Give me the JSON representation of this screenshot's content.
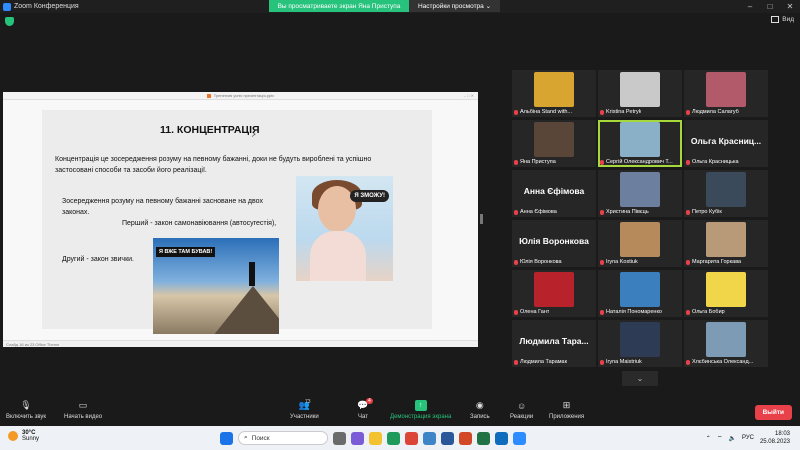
{
  "window": {
    "title": "Zoom Конференция"
  },
  "banner": {
    "viewing": "Вы просматриваете экран Яна Приступа",
    "settings": "Настройки просмотра"
  },
  "view_label": "Вид",
  "share": {
    "tab_title": "Тренінгові успіх презентація.pptx",
    "slide": {
      "title": "11. КОНЦЕНТРАЦІЯ",
      "cursor": "↗",
      "p1": "Концентрація це зосередження розуму на певному бажанні, доки не будуть вироблені та успішно застосовані способи та засоби його реалізації.",
      "p2": "Зосередження розуму на певному бажанні засноване на двох законах.",
      "p3": "Перший - закон самонавіювання (автосугестія),",
      "p4": "Другий - закон звички.",
      "img1_caption": "Я ЗМОЖУ!",
      "img2_caption": "Я ВЖЕ ТАМ БУВАВ!"
    },
    "status": "Слайд 16 из 23    Office Theme"
  },
  "participants": [
    {
      "name": "Альбіна Stand with...",
      "big": "",
      "color": "#d8a531"
    },
    {
      "name": "Kristina Petryk",
      "big": "",
      "color": "#c9c9c9"
    },
    {
      "name": "Людмила Салагуб",
      "big": "",
      "color": "#b35a6a"
    },
    {
      "name": "Яна Приступа",
      "big": "",
      "color": "#5a4638"
    },
    {
      "name": "Сергій Олександрович Т...",
      "big": "",
      "color": "#8ab0c8"
    },
    {
      "name": "Ольга Красницька",
      "big": "Ольга  Красниц...",
      "color": ""
    },
    {
      "name": "Анна Єфімова",
      "big": "Анна  Єфімова",
      "color": ""
    },
    {
      "name": "Христина Півєць",
      "big": "",
      "color": "#6d7f9e"
    },
    {
      "name": "Петро Кубік",
      "big": "",
      "color": "#3a4a5a"
    },
    {
      "name": "Юлія Воронкова",
      "big": "Юлія  Воронкова",
      "color": ""
    },
    {
      "name": "Iryna Kostiuk",
      "big": "",
      "color": "#b68a5a"
    },
    {
      "name": "Маргарита Горкава",
      "big": "",
      "color": "#b89a78"
    },
    {
      "name": "Олена Гант",
      "big": "",
      "color": "#b8232b"
    },
    {
      "name": "Наталія Пономаренко",
      "big": "",
      "color": "#3b7fbf"
    },
    {
      "name": "Ольга Бобир",
      "big": "",
      "color": "#f2d64a"
    },
    {
      "name": "Людмила Тарамак",
      "big": "Людмила  Тара...",
      "color": ""
    },
    {
      "name": "Iryna Maistriuk",
      "big": "",
      "color": "#2e3b55"
    },
    {
      "name": "Хлєбинська Олександ...",
      "big": "",
      "color": "#7d9bb5"
    }
  ],
  "toolbar": {
    "mute": "Включить звук",
    "video": "Начать видео",
    "participants": "Участники",
    "participants_count": "73",
    "chat": "Чат",
    "chat_badge": "4",
    "share": "Демонстрация экрана",
    "record": "Запись",
    "reactions": "Реакции",
    "apps": "Приложения",
    "leave": "Выйти"
  },
  "taskbar": {
    "temp": "30°C",
    "weather": "Sunny",
    "search": "Поиск",
    "lang": "РУС",
    "time": "18:03",
    "date": "25.08.2023"
  }
}
